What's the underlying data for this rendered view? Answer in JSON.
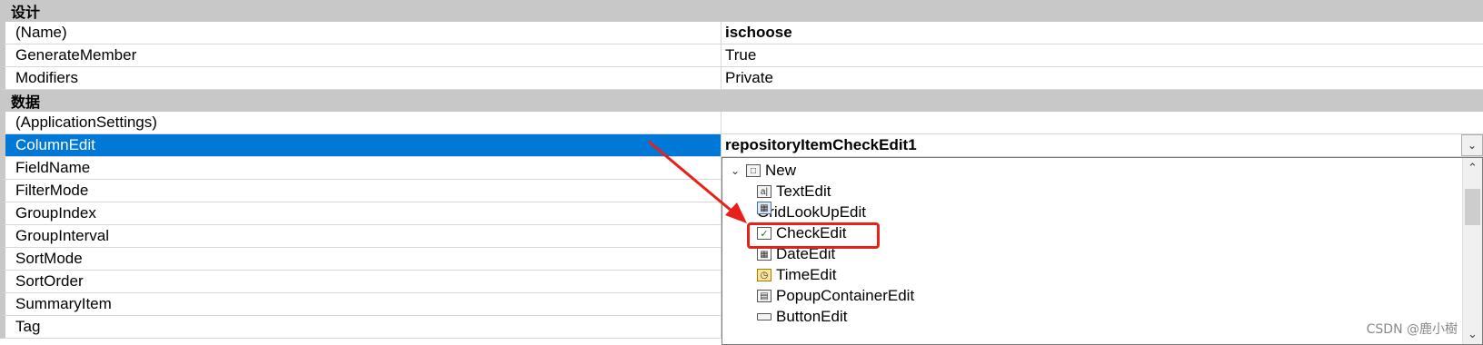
{
  "categories": {
    "design": "设计",
    "data": "数据"
  },
  "design_rows": [
    {
      "name": "(Name)",
      "value": "ischoose"
    },
    {
      "name": "GenerateMember",
      "value": "True"
    },
    {
      "name": "Modifiers",
      "value": "Private"
    }
  ],
  "data_rows": [
    {
      "name": "(ApplicationSettings)",
      "value": ""
    },
    {
      "name": "ColumnEdit",
      "value": "repositoryItemCheckEdit1"
    },
    {
      "name": "FieldName",
      "value": ""
    },
    {
      "name": "FilterMode",
      "value": ""
    },
    {
      "name": "GroupIndex",
      "value": ""
    },
    {
      "name": "GroupInterval",
      "value": ""
    },
    {
      "name": "SortMode",
      "value": ""
    },
    {
      "name": "SortOrder",
      "value": ""
    },
    {
      "name": "SummaryItem",
      "value": ""
    },
    {
      "name": "Tag",
      "value": ""
    }
  ],
  "dropdown": {
    "root": "New",
    "items": [
      {
        "label": "TextEdit",
        "icon": "textedit-icon"
      },
      {
        "label": "GridLookUpEdit",
        "icon": "gridlookup-icon"
      },
      {
        "label": "CheckEdit",
        "icon": "checkbox-icon"
      },
      {
        "label": "DateEdit",
        "icon": "calendar-icon"
      },
      {
        "label": "TimeEdit",
        "icon": "clock-icon"
      },
      {
        "label": "PopupContainerEdit",
        "icon": "popup-icon"
      },
      {
        "label": "ButtonEdit",
        "icon": "button-icon"
      }
    ]
  },
  "watermark": "CSDN @鹿小樹",
  "colors": {
    "selected_bg": "#0078d7",
    "highlight": "#e8201a",
    "category_bg": "#c8c8c8"
  }
}
